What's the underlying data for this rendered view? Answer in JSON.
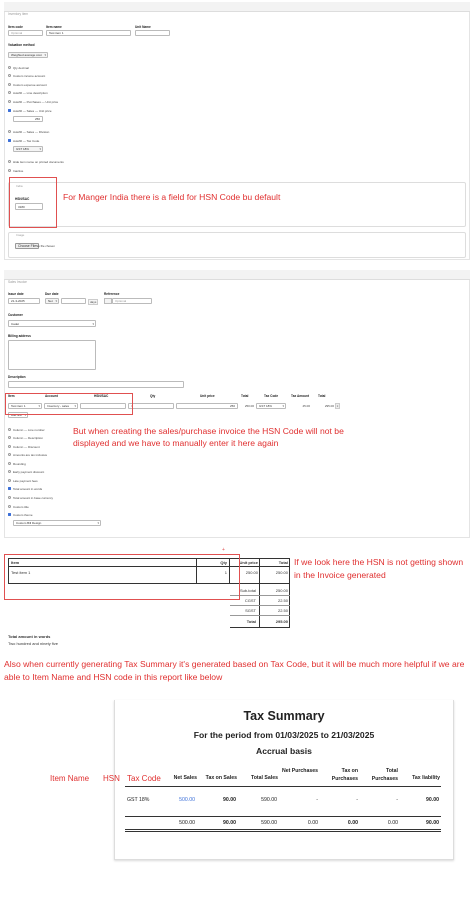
{
  "item_form": {
    "header": "Inventory item",
    "item_code_label": "Item code",
    "item_code_placeholder": "Optional",
    "item_name_label": "Item name",
    "item_name_value": "Test item 1",
    "unit_name_label": "Unit Name",
    "valuation_label": "Valuation method",
    "valuation_value": "Weighted average cost",
    "options": [
      {
        "kind": "check",
        "label": "Qty decimal",
        "on": false
      },
      {
        "kind": "check",
        "label": "Custom income account",
        "on": false
      },
      {
        "kind": "check",
        "label": "Custom expense account",
        "on": false
      },
      {
        "kind": "check",
        "label": "Autofill — Line description",
        "on": false
      },
      {
        "kind": "check",
        "label": "Autofill — Purchases — Unit price",
        "on": false
      },
      {
        "kind": "check",
        "label": "Autofill — Sales — Unit price",
        "on": true
      }
    ],
    "sales_unit_price": "250",
    "options2": [
      {
        "label": "Autofill — Sales — Division",
        "on": false
      },
      {
        "label": "Autofill — Tax Code",
        "on": true
      }
    ],
    "tax_code_value": "GST 18%",
    "options3": [
      {
        "label": "Hide item name on printed documents",
        "on": false
      },
      {
        "label": "Inactive",
        "on": false
      }
    ],
    "india_section_label": "India",
    "hsn_label": "HSN/SAC",
    "hsn_value": "3180",
    "image_label": "Image",
    "choose_file": "Choose File",
    "no_file": "No file chosen"
  },
  "note1": "For Manger India there is a field for HSN Code bu default",
  "invoice_form": {
    "header": "Sales Invoice",
    "issue_date_label": "Issue date",
    "issue_date_value": "21-3-2025",
    "due_date_label": "Due date",
    "due_date_value": "Net",
    "due_days": "",
    "due_unit": "days",
    "reference_label": "Reference",
    "reference_placeholder": "Optional",
    "customer_label": "Customer",
    "customer_value": "Cadet",
    "billing_label": "Billing address",
    "description_label": "Description",
    "columns": [
      "Item",
      "Account",
      "HSN/SAC",
      "Qty",
      "Unit price",
      "Total",
      "Tax Code",
      "Tax Amount",
      "Total"
    ],
    "row": {
      "item": "Test item 1",
      "account": "Inventory - sales",
      "hsn": "",
      "qty": "1",
      "unit_price": "250",
      "total": "250.00",
      "tax_code": "GST 18%",
      "tax_amount": "45.00",
      "total2": "295.00"
    },
    "add_line": "Add line",
    "options": [
      {
        "label": "Column — Line number",
        "on": false
      },
      {
        "label": "Column — Description",
        "on": false
      },
      {
        "label": "Column — Discount",
        "on": false
      },
      {
        "label": "Amounts are tax inclusive",
        "on": false
      },
      {
        "label": "Rounding",
        "on": false
      },
      {
        "label": "Early payment discount",
        "on": false
      },
      {
        "label": "Late payment fees",
        "on": false
      },
      {
        "label": "Total amount in words",
        "on": true
      },
      {
        "label": "Total amount in base currency",
        "on": false
      },
      {
        "label": "Custom title",
        "on": false
      },
      {
        "label": "Custom theme",
        "on": true
      }
    ],
    "theme_value": "Custom Bill Design"
  },
  "note2": "But when creating the sales/purchase invoice the HSN Code will not be displayed and we have to manually enter it here again",
  "printed_invoice": {
    "headers": [
      "Item",
      "Qty",
      "Unit price",
      "Total"
    ],
    "row": {
      "item": "Test item 1",
      "qty": "1",
      "unit_price": "250.00",
      "total": "250.00"
    },
    "subtotal_label": "Sub-total",
    "subtotal": "250.00",
    "cgst_label": "CGST",
    "cgst": "22.50",
    "sgst_label": "SGST",
    "sgst": "22.50",
    "total_label": "Total",
    "total": "295.00",
    "words_label": "Total amount in words",
    "words_value": "Two hundred and ninety five"
  },
  "note3": "If we look here the HSN is not getting shown in the Invoice generated",
  "note4": "Also when currently generating Tax Summary it's generated based on Tax Code, but it will be much more helpful if we are able to Item Name and HSN code in this report like below",
  "tax_summary": {
    "title": "Tax Summary",
    "period": "For the period from 01/03/2025 to 21/03/2025",
    "basis": "Accrual basis",
    "extra_columns": [
      "Item Name",
      "HSN"
    ],
    "columns": [
      "Tax Code",
      "Net Sales",
      "Tax on Sales",
      "Total Sales",
      "Net Purchases",
      "Tax on Purchases",
      "Total Purchases",
      "Tax liability"
    ],
    "row": {
      "tax_code": "GST 18%",
      "net_sales": "500.00",
      "tax_on_sales": "90.00",
      "total_sales": "590.00",
      "net_purchases": "-",
      "tax_on_purchases": "-",
      "total_purchases": "-",
      "tax_liability": "90.00"
    },
    "totals": {
      "net_sales": "500.00",
      "tax_on_sales": "90.00",
      "total_sales": "590.00",
      "net_purchases": "0.00",
      "tax_on_purchases": "0.00",
      "total_purchases": "0.00",
      "tax_liability": "90.00"
    },
    "link_color": "#3b6fd8",
    "annotation_color": "#e03030"
  }
}
